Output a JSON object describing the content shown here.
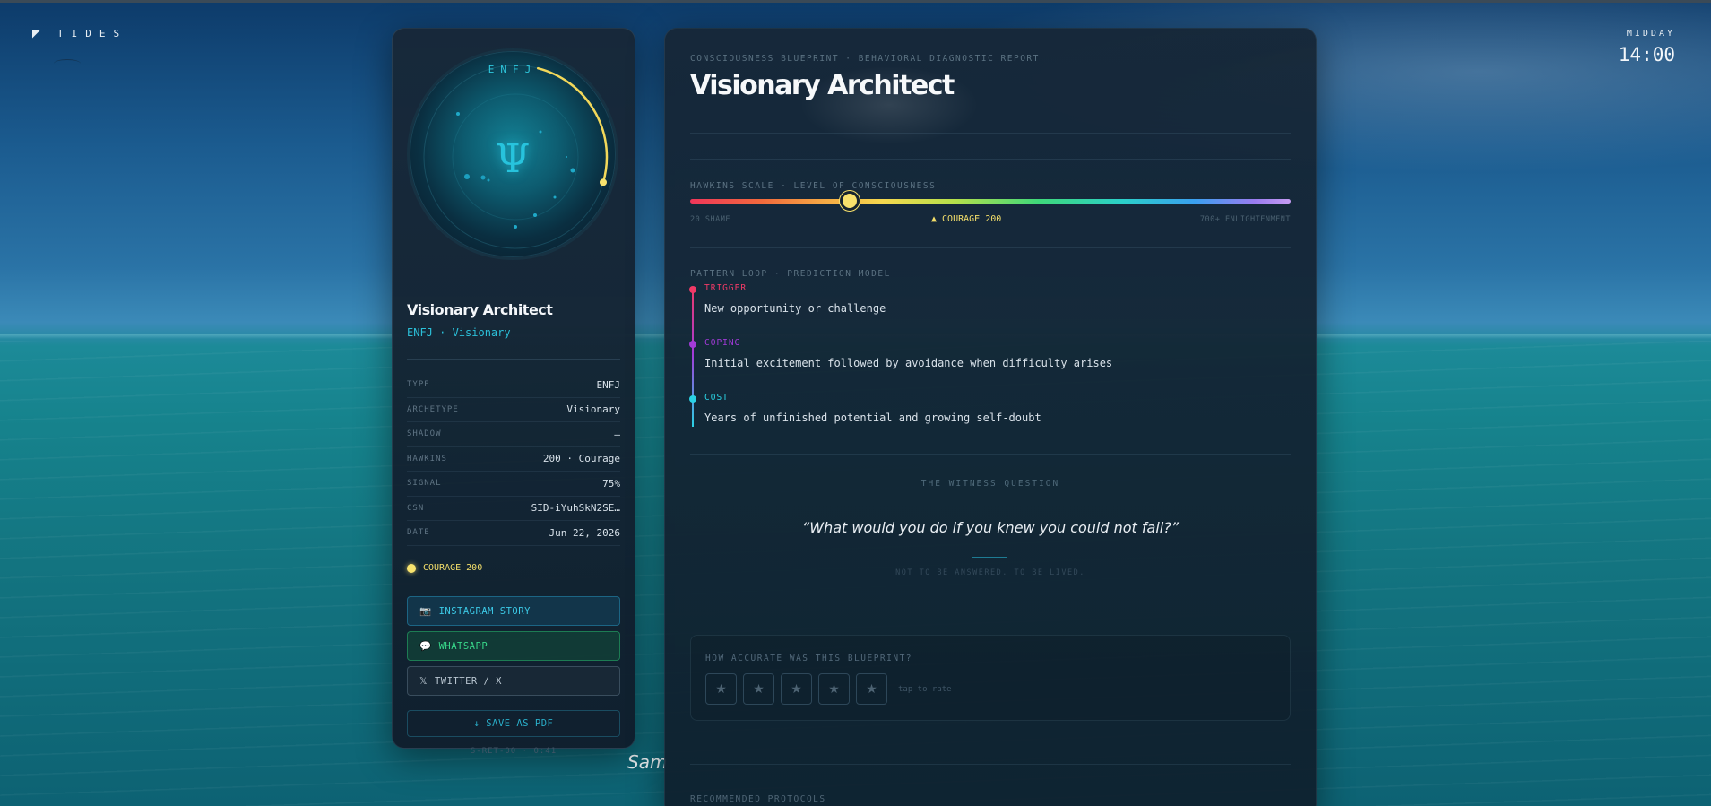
{
  "brand": {
    "name": "TIDES"
  },
  "clock": {
    "period": "MIDDAY",
    "time": "14:00"
  },
  "signature": "Sam",
  "profile": {
    "type_code": "ENFJ",
    "glyph": "Ψ",
    "title": "Visionary Architect",
    "subtitle": "ENFJ · Visionary",
    "details": [
      {
        "key": "TYPE",
        "value": "ENFJ"
      },
      {
        "key": "ARCHETYPE",
        "value": "Visionary"
      },
      {
        "key": "SHADOW",
        "value": "—"
      },
      {
        "key": "HAWKINS",
        "value": "200 · Courage"
      },
      {
        "key": "SIGNAL",
        "value": "75%"
      },
      {
        "key": "CSN",
        "value": "SID-iYuhSkN2SE…"
      },
      {
        "key": "DATE",
        "value": "Jun 22, 2026"
      }
    ],
    "level_badge": "COURAGE 200",
    "orb_progress": 0.3,
    "share_buttons": {
      "instagram": {
        "icon": "camera-icon",
        "label": "INSTAGRAM STORY"
      },
      "whatsapp": {
        "icon": "speech-bubble-icon",
        "label": "WHATSAPP"
      },
      "twitter": {
        "icon": "x-logo-icon",
        "label": "TWITTER / X"
      }
    },
    "save_pdf": "↓ SAVE AS PDF",
    "footer": "S-RET-00 · 0:41"
  },
  "report": {
    "eyebrow": "CONSCIOUSNESS BLUEPRINT · BEHAVIORAL DIAGNOSTIC REPORT",
    "title": "Visionary Architect",
    "hawkins": {
      "heading": "HAWKINS SCALE · LEVEL OF CONSCIOUSNESS",
      "min_label": "20 SHAME",
      "max_label": "700+ ENLIGHTENMENT",
      "current_label": "▲ COURAGE 200",
      "min": 20,
      "max": 700,
      "value": 200
    },
    "pattern_loop": {
      "heading": "PATTERN LOOP · PREDICTION MODEL",
      "steps": [
        {
          "label": "TRIGGER",
          "text": "New opportunity or challenge",
          "color": "#f03a66"
        },
        {
          "label": "COPING",
          "text": "Initial excitement followed by avoidance when difficulty arises",
          "color": "#a23bd8"
        },
        {
          "label": "COST",
          "text": "Years of unfinished potential and growing self-doubt",
          "color": "#2ad2e4"
        }
      ]
    },
    "witness": {
      "heading": "THE WITNESS QUESTION",
      "question": "“What would you do if you knew you could not fail?”",
      "subtext": "NOT TO BE ANSWERED. TO BE LIVED."
    },
    "rating": {
      "question": "HOW ACCURATE WAS THIS BLUEPRINT?",
      "star": "★",
      "star_count": 5,
      "hint": "tap to rate"
    },
    "protocols_heading": "RECOMMENDED PROTOCOLS"
  },
  "colors": {
    "accent_cyan": "#2bbfd8",
    "courage_yellow": "#f8e16c",
    "whatsapp_green": "#38d78a"
  }
}
